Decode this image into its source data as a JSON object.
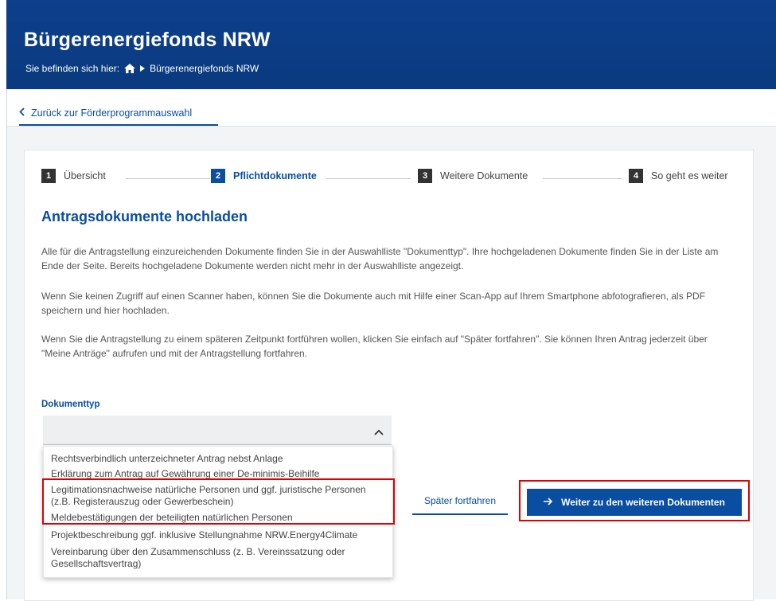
{
  "header": {
    "title": "Bürgerenergiefonds NRW",
    "breadcrumb_prefix": "Sie befinden sich hier:",
    "breadcrumb_current": "Bürgerenergiefonds NRW"
  },
  "nav": {
    "back_label": "Zurück zur Förderprogrammauswahl"
  },
  "stepper": {
    "steps": [
      {
        "number": "1",
        "label": "Übersicht",
        "active": false
      },
      {
        "number": "2",
        "label": "Pflichtdokumente",
        "active": true
      },
      {
        "number": "3",
        "label": "Weitere Dokumente",
        "active": false
      },
      {
        "number": "4",
        "label": "So geht es weiter",
        "active": false
      }
    ]
  },
  "main": {
    "heading": "Antragsdokumente hochladen",
    "paragraphs": [
      "Alle für die Antragstellung einzureichenden Dokumente finden Sie in der Auswahlliste \"Dokumenttyp\". Ihre hochgeladenen Dokumente finden Sie in der Liste am Ende der Seite. Bereits hochgeladene Dokumente werden nicht mehr in der Auswahlliste angezeigt.",
      "Wenn Sie keinen Zugriff auf einen Scanner haben, können Sie die Dokumente auch mit Hilfe einer Scan-App auf Ihrem Smartphone abfotografieren, als PDF speichern und hier hochladen.",
      "Wenn Sie die Antragstellung zu einem späteren Zeitpunkt fortführen wollen, klicken Sie einfach auf \"Später fortfahren\". Sie können Ihren Antrag jederzeit über \"Meine Anträge\" aufrufen und mit der Antragstellung fortfahren."
    ]
  },
  "document_type": {
    "label": "Dokumenttyp",
    "selected": "",
    "options": [
      "Rechtsverbindlich unterzeichneter Antrag nebst Anlage",
      "Erklärung zum Antrag auf Gewährung einer De-minimis-Beihilfe",
      "Legitimationsnachweise natürliche Personen und ggf. juristische Personen (z.B. Registerauszug oder Gewerbeschein)",
      "Meldebestätigungen der beteiligten natürlichen Personen",
      "Projektbeschreibung ggf. inklusive Stellungnahme NRW.Energy4Climate",
      "Vereinbarung über den Zusammenschluss (z. B. Vereinssatzung oder Gesellschaftsvertrag)"
    ]
  },
  "actions": {
    "later_label": "Später fortfahren",
    "next_label": "Weiter zu den weiteren Dokumenten"
  },
  "colors": {
    "header_bg": "#0c3c86",
    "primary": "#0a4ea1",
    "highlight_border": "#e00000"
  },
  "icons": [
    "home-icon",
    "breadcrumb-arrow-icon",
    "chevron-left-icon",
    "chevron-up-icon",
    "arrow-right-icon"
  ]
}
